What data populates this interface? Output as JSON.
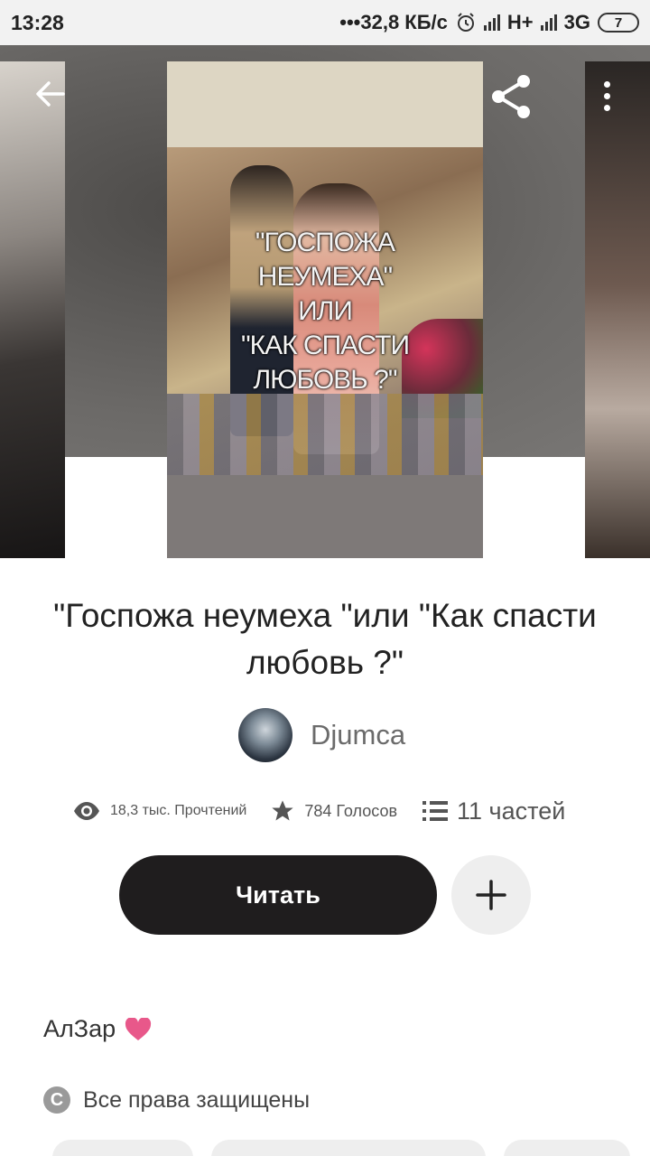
{
  "status_bar": {
    "time": "13:28",
    "network_speed": "•••32,8 КБ/с",
    "network1": "H+",
    "network2": "3G",
    "battery": "7"
  },
  "story": {
    "cover_lines": [
      "\"ГОСПОЖА",
      "НЕУМЕХА\"",
      "ИЛИ",
      "\"КАК СПАСТИ",
      "ЛЮБОВЬ ?\""
    ],
    "title": "\"Госпожа неумеха \"или \"Как спасти любовь ?\"",
    "author": "Djumca"
  },
  "stats": {
    "reads": "18,3 тыс. Прочтений",
    "votes": "784 Голосов",
    "parts": "11 частей"
  },
  "actions": {
    "read_label": "Читать",
    "add_icon": "plus-icon"
  },
  "description": {
    "dedication": "АлЗар",
    "heart_icon": "heart-icon",
    "copyright": "Все права защищены"
  },
  "colors": {
    "read_button": "#1f1d1e",
    "heart": "#e8588a"
  }
}
